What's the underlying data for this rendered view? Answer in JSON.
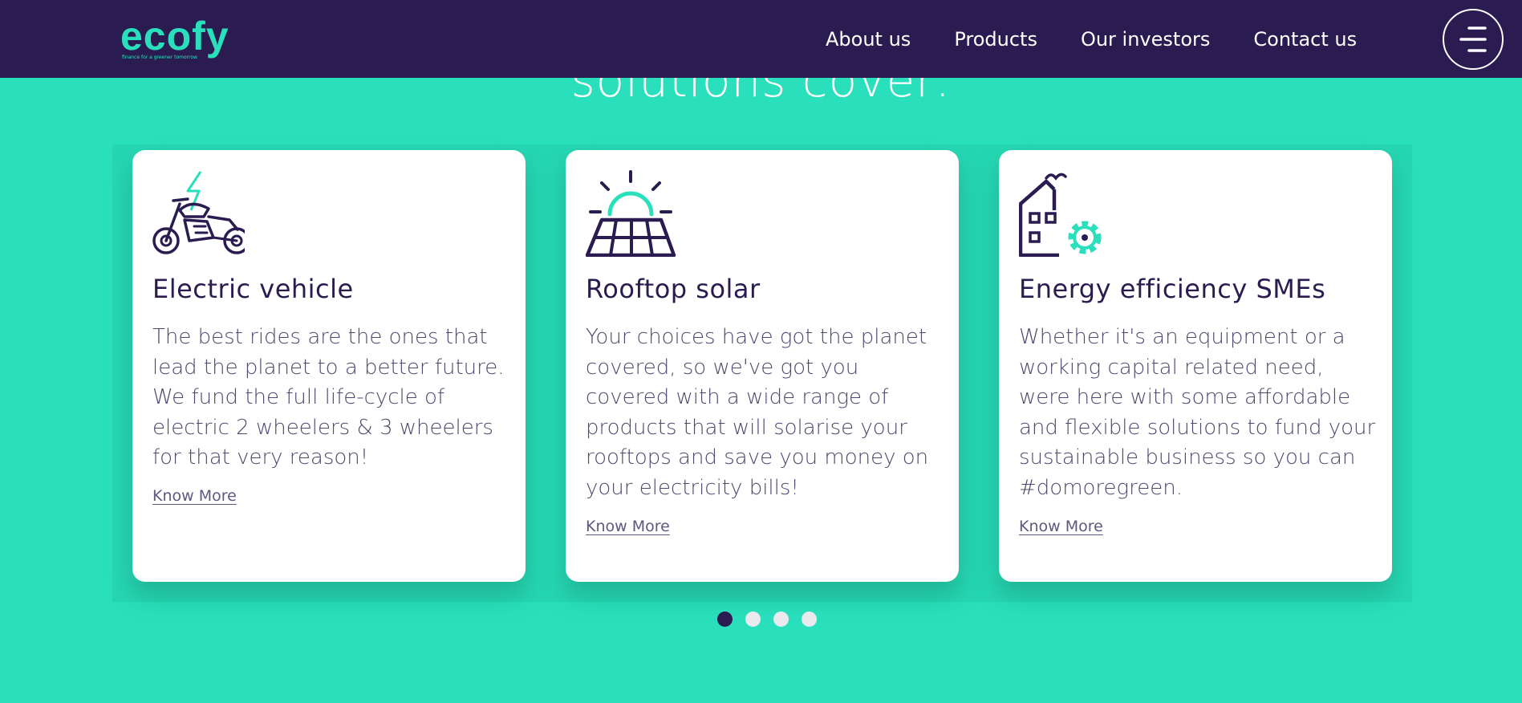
{
  "header": {
    "logo": "ecofy",
    "tagline": "finance for a greener tomorrow",
    "nav": [
      "About us",
      "Products",
      "Our investors",
      "Contact us"
    ],
    "menu_icon": "hamburger-menu-icon"
  },
  "section": {
    "heading": "solutions cover:"
  },
  "cards": [
    {
      "icon": "electric-motorcycle-icon",
      "title": "Electric vehicle",
      "description": "The best rides are the ones that lead the planet to a better future. We fund the full life-cycle of electric 2 wheelers & 3 wheelers for that very reason!",
      "link": "Know More"
    },
    {
      "icon": "solar-panel-icon",
      "title": "Rooftop solar",
      "description": "Your choices have got the planet covered, so we've got you covered with a wide range of products that will solarise your rooftops and save you money on your electricity bills!",
      "link": "Know More"
    },
    {
      "icon": "factory-gear-icon",
      "title": "Energy efficiency SMEs",
      "description": "Whether it's an equipment or a working capital related need, were here with some affordable and flexible solutions to fund your sustainable business so you can #domoregreen.",
      "link": "Know More"
    }
  ],
  "carousel": {
    "total_slides": 4,
    "active_slide": 1
  },
  "colors": {
    "brand_teal": "#2ae0bc",
    "brand_navy": "#2a1b50",
    "card_bg": "#ffffff",
    "dot_inactive": "#e9e9ee"
  }
}
